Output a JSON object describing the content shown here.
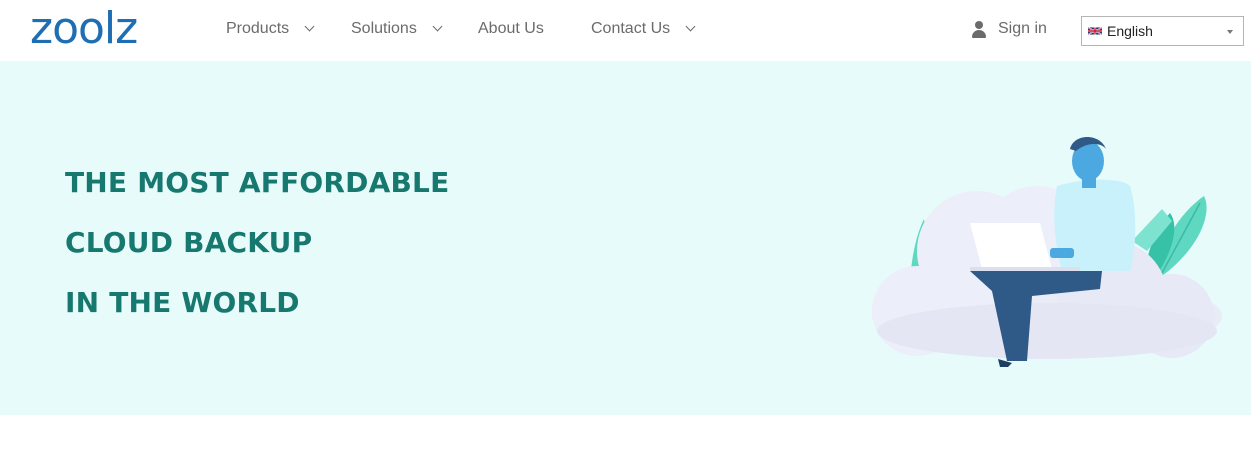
{
  "header": {
    "logo_text": "zoolz",
    "nav": [
      {
        "label": "Products",
        "has_dropdown": true
      },
      {
        "label": "Solutions",
        "has_dropdown": true
      },
      {
        "label": "About Us",
        "has_dropdown": false
      },
      {
        "label": "Contact Us",
        "has_dropdown": true
      }
    ],
    "sign_in_label": "Sign in",
    "language": {
      "selected": "English"
    }
  },
  "hero": {
    "headline_lines": [
      "THE MOST AFFORDABLE",
      "CLOUD BACKUP",
      "IN THE WORLD"
    ]
  },
  "colors": {
    "brand_blue": "#1f6db3",
    "headline_green": "#16786e",
    "hero_background": "#e8fbfb",
    "nav_text": "#6b6b6b"
  },
  "icons": {
    "user": "user-icon",
    "flag": "uk-flag-icon",
    "chevron": "chevron-down-icon",
    "caret": "caret-down-icon"
  }
}
